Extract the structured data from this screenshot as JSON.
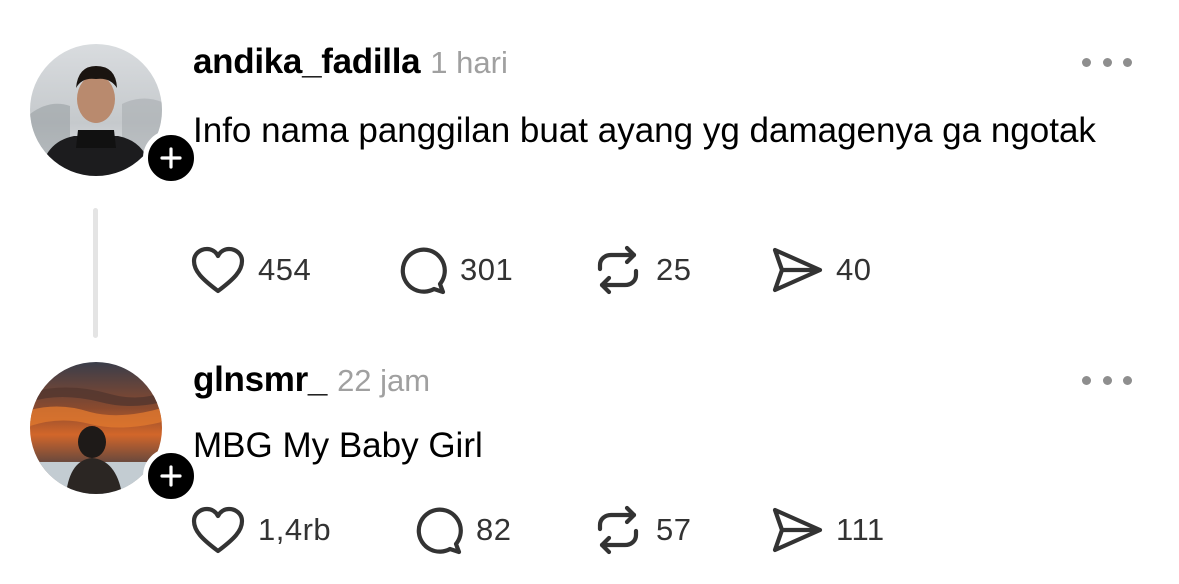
{
  "posts": [
    {
      "username": "andika_fadilla",
      "time": "1 hari",
      "text": "Info nama panggilan buat ayang yg damagenya ga ngotak",
      "likes": "454",
      "replies": "301",
      "reposts": "25",
      "shares": "40"
    },
    {
      "username": "glnsmr_",
      "time": "22 jam",
      "text": "MBG My Baby Girl",
      "likes": "1,4rb",
      "replies": "82",
      "reposts": "57",
      "shares": "111"
    }
  ],
  "icons": {
    "like": "heart-icon",
    "reply": "comment-bubble-icon",
    "repost": "repost-icon",
    "share": "send-icon",
    "follow": "plus-icon",
    "more": "more-dots-icon"
  },
  "colors": {
    "text": "#000000",
    "muted": "#a0a0a0",
    "count": "#333333",
    "thread_line": "#e4e4e4"
  }
}
